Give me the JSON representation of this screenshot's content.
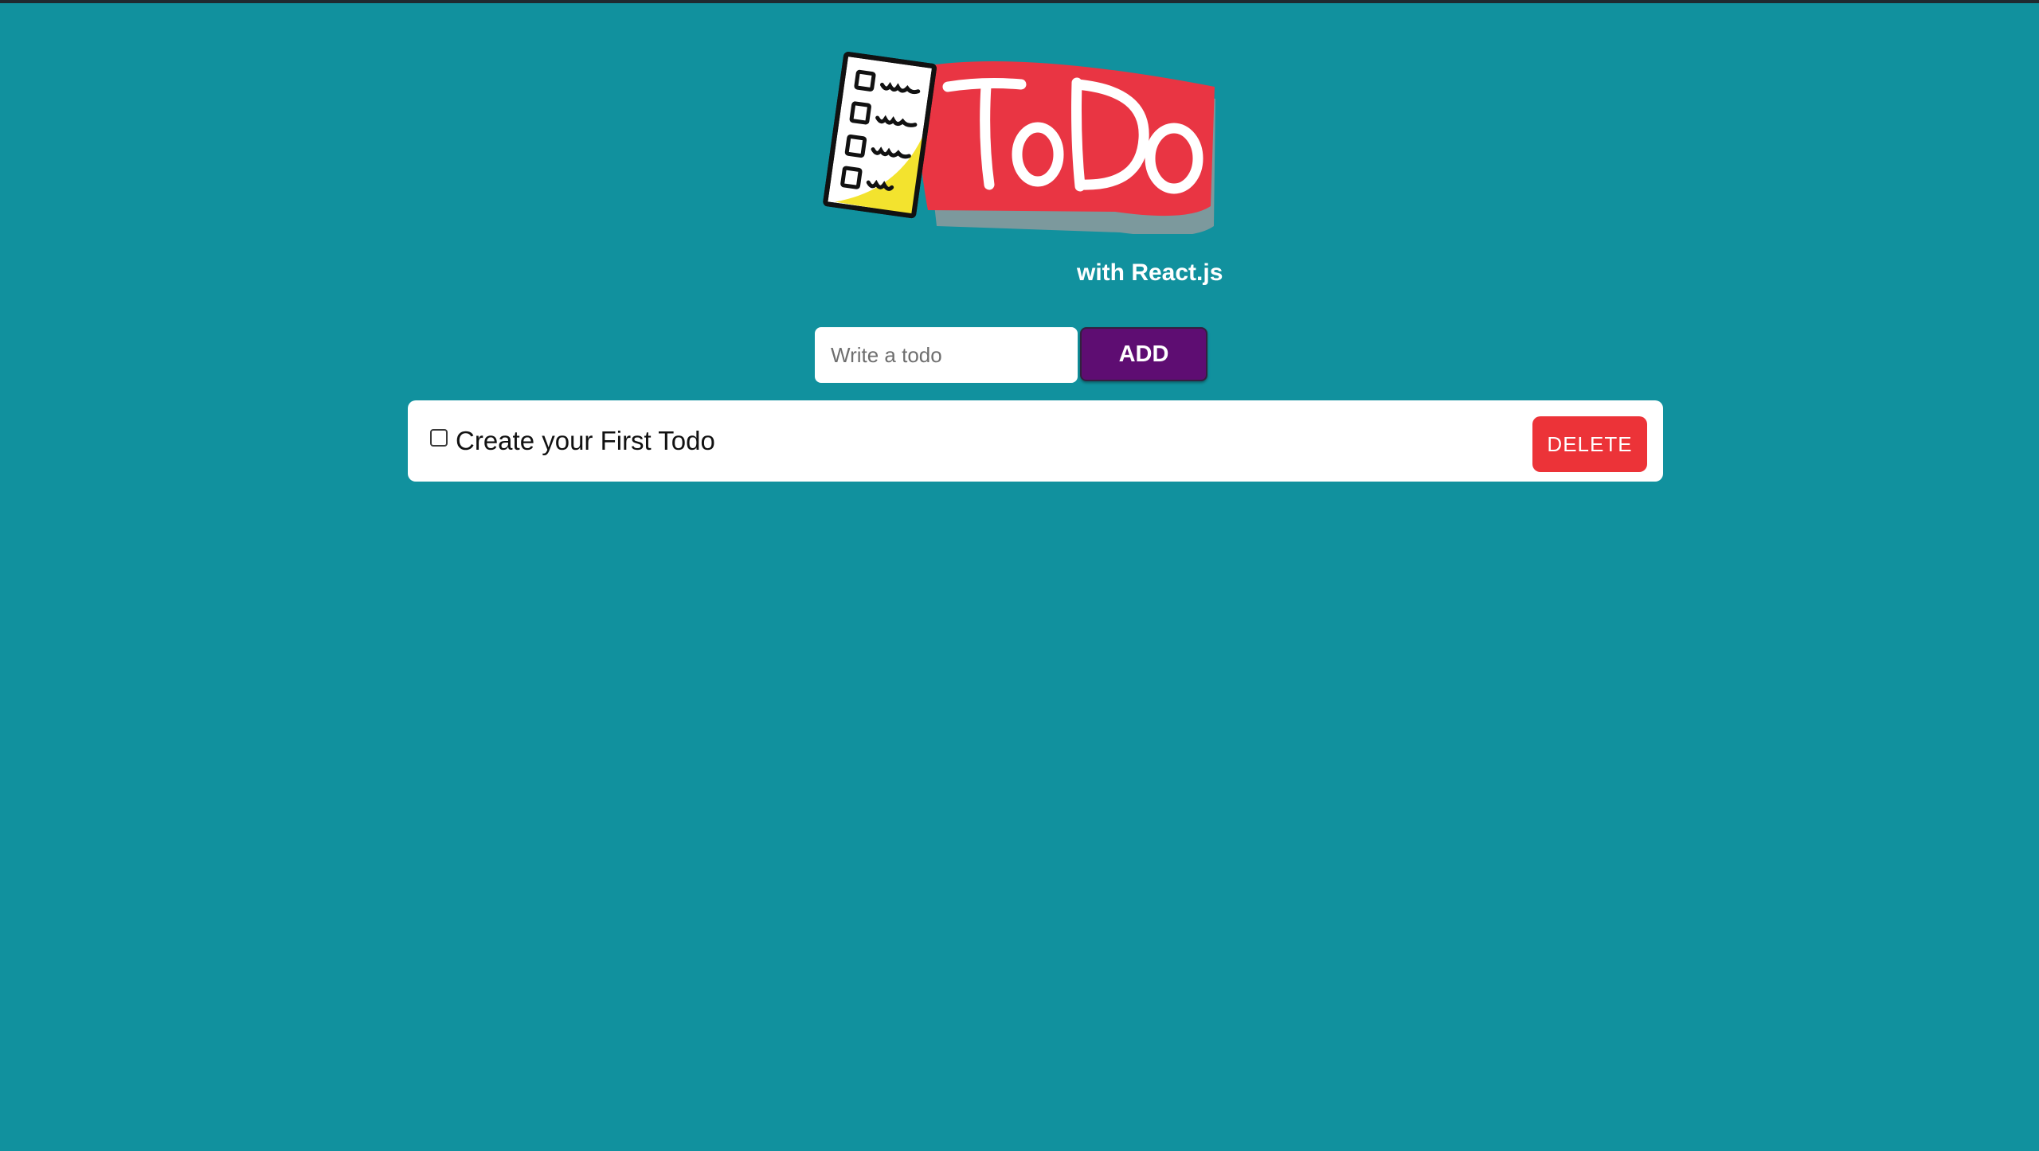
{
  "header": {
    "logo_text": "ToDo",
    "subtitle": "with React.js"
  },
  "form": {
    "input_placeholder": "Write a todo",
    "input_value": "",
    "add_label": "ADD"
  },
  "todos": [
    {
      "text": "Create your First Todo",
      "completed": false,
      "delete_label": "DELETE"
    }
  ],
  "colors": {
    "background": "#11919e",
    "logo_banner": "#e93543",
    "add_button": "#5e0d72",
    "delete_button": "#ec3338"
  }
}
